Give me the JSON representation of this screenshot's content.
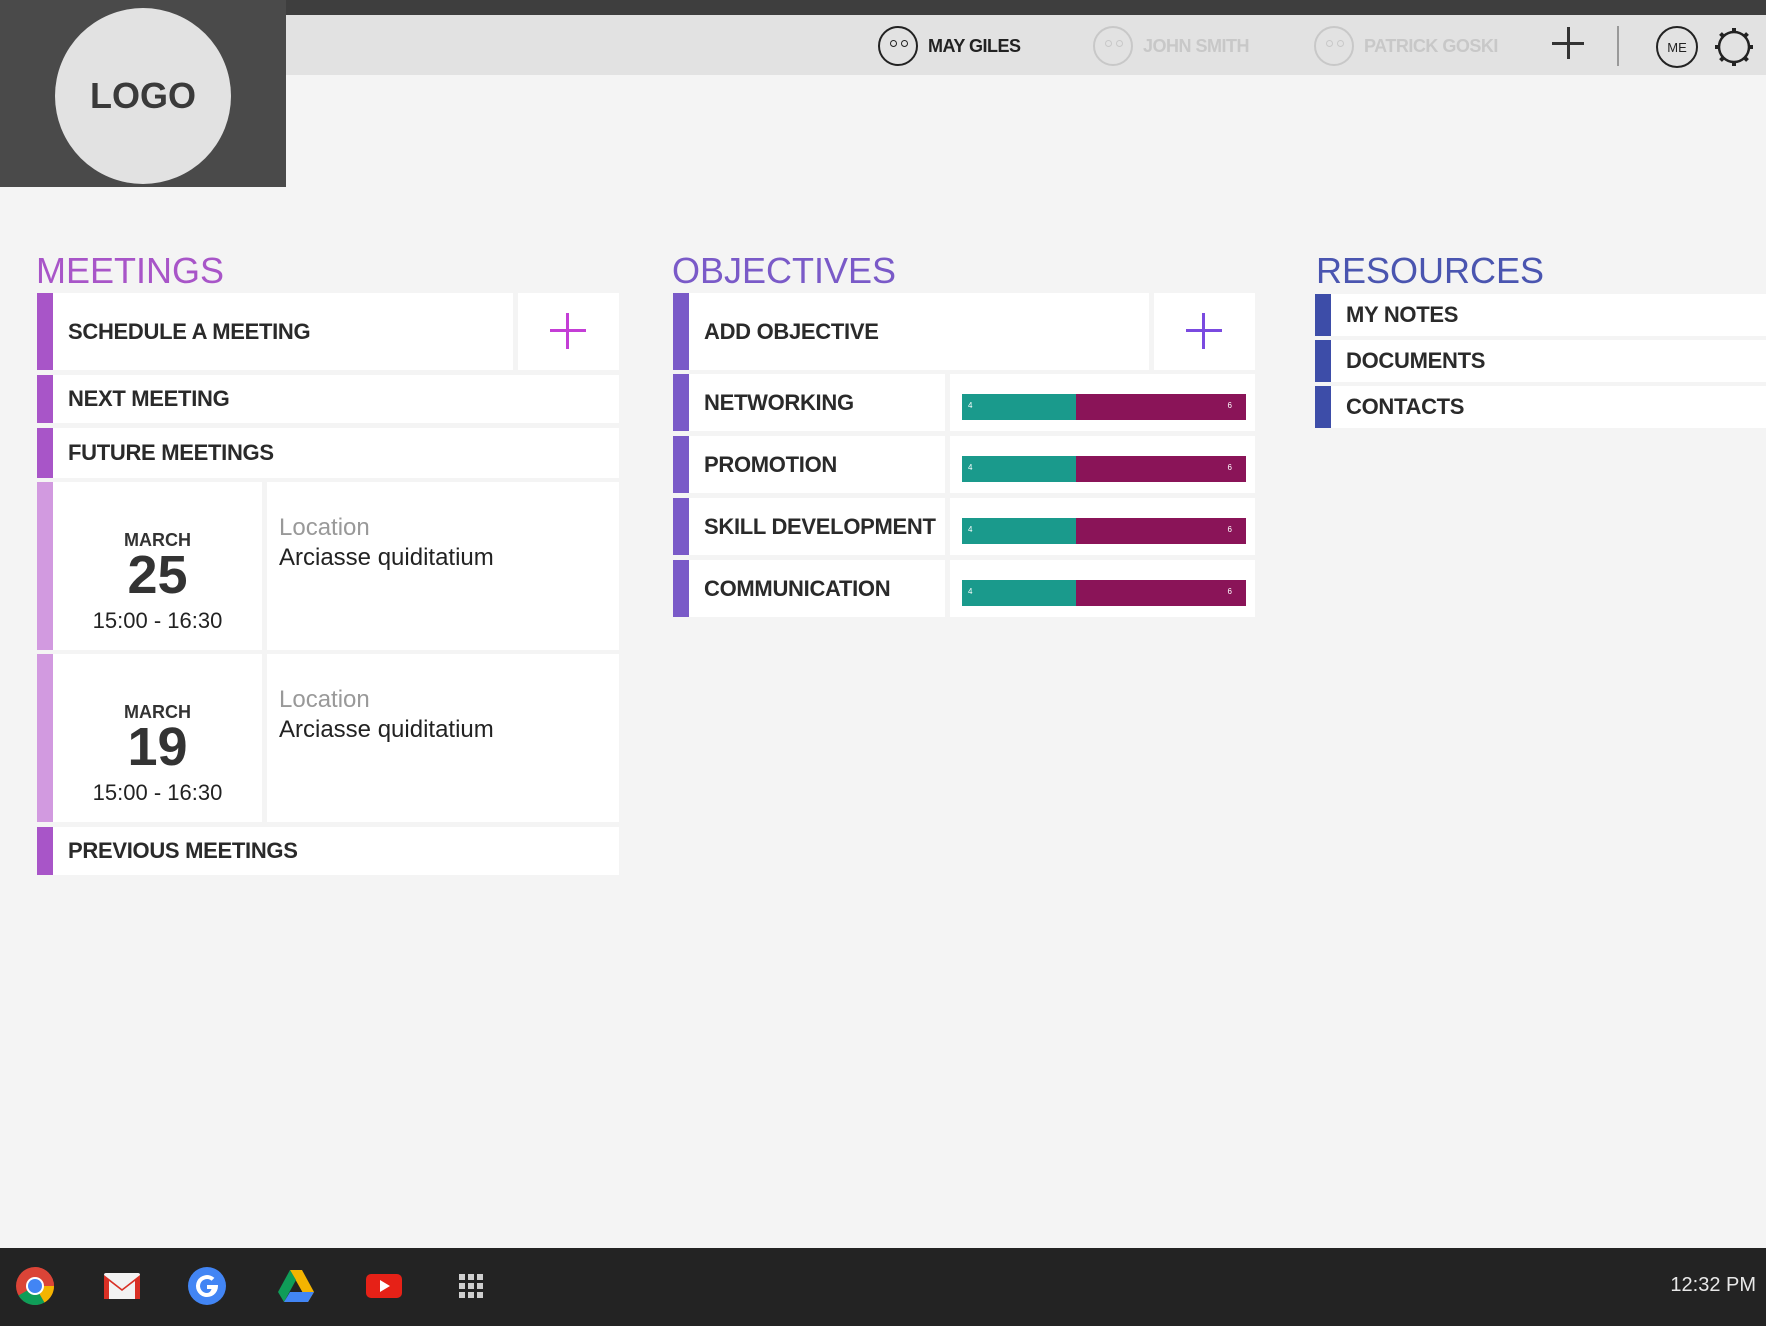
{
  "logo": "LOGO",
  "header": {
    "users": [
      {
        "name": "MAY GILES",
        "active": true
      },
      {
        "name": "JOHN SMITH",
        "active": false
      },
      {
        "name": "PATRICK GOSKI",
        "active": false
      }
    ],
    "me_label": "ME"
  },
  "meetings": {
    "title": "MEETINGS",
    "schedule": "SCHEDULE A MEETING",
    "next": "NEXT MEETING",
    "future": "FUTURE MEETINGS",
    "items": [
      {
        "month": "MARCH",
        "day": "25",
        "time": "15:00 - 16:30",
        "location_label": "Location",
        "location": "Arciasse quiditatium"
      },
      {
        "month": "MARCH",
        "day": "19",
        "time": "15:00 - 16:30",
        "location_label": "Location",
        "location": "Arciasse quiditatium"
      }
    ],
    "previous": "PREVIOUS MEETINGS"
  },
  "objectives": {
    "title": "OBJECTIVES",
    "add": "ADD OBJECTIVE",
    "items": [
      {
        "name": "NETWORKING",
        "done": 4,
        "remaining": 6
      },
      {
        "name": "PROMOTION",
        "done": 4,
        "remaining": 6
      },
      {
        "name": "SKILL DEVELOPMENT",
        "done": 4,
        "remaining": 6
      },
      {
        "name": "COMMUNICATION",
        "done": 4,
        "remaining": 6
      }
    ]
  },
  "resources": {
    "title": "RESOURCES",
    "items": [
      "MY NOTES",
      "DOCUMENTS",
      "CONTACTS"
    ]
  },
  "taskbar": {
    "apps": [
      "chrome-icon",
      "gmail-icon",
      "google-icon",
      "drive-icon",
      "youtube-icon",
      "apps-grid-icon"
    ],
    "clock": "12:32 PM"
  },
  "colors": {
    "meetings_accent": "#a855c8",
    "objectives_accent": "#7a5ac8",
    "resources_accent": "#3d4da8",
    "progress_done": "#1a9a8c",
    "progress_remaining": "#8a1458"
  }
}
